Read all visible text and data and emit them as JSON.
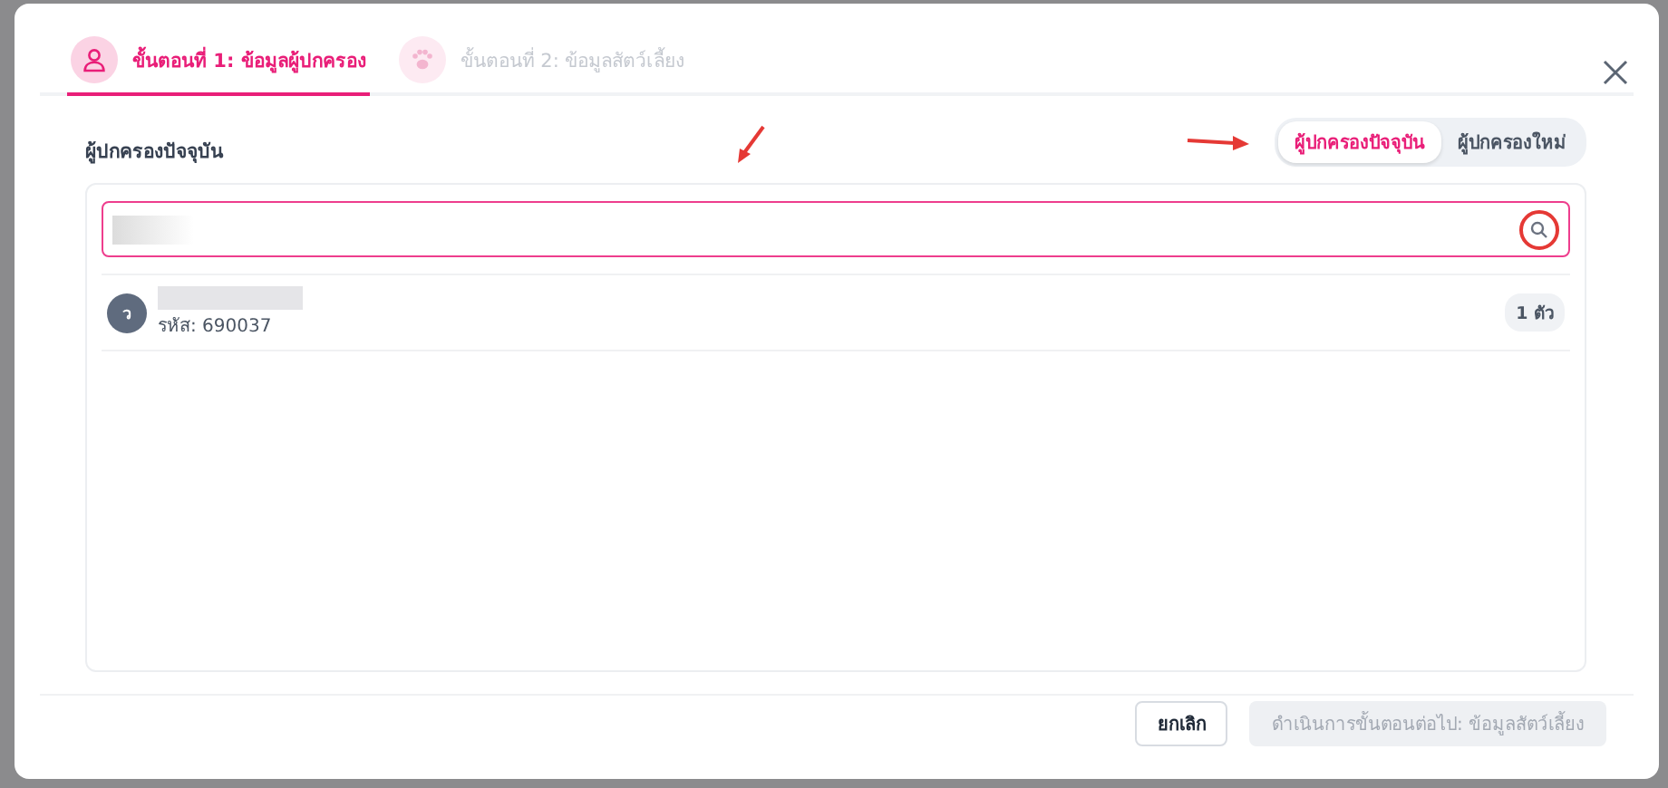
{
  "steps": [
    {
      "label": "ขั้นตอนที่ 1: ข้อมูลผู้ปกครอง",
      "kind": "person",
      "selected": true
    },
    {
      "label": "ขั้นตอนที่ 2: ข้อมูลสัตว์เลี้ยง",
      "kind": "paw",
      "selected": false
    }
  ],
  "section_title": "ผู้ปกครองปัจจุบัน",
  "mode_toggle": [
    {
      "label": "ผู้ปกครองปัจจุบัน",
      "selected": true
    },
    {
      "label": "ผู้ปกครองใหม่",
      "selected": false
    }
  ],
  "results": [
    {
      "avatar": "ว",
      "code": "รหัส: 690037",
      "badge": "1 ตัว"
    }
  ],
  "buttons": [
    {
      "label": "ยกเลิก",
      "disabled": false
    },
    {
      "label": "ดำเนินการขั้นตอนต่อไป: ข้อมูลสัตว์เลี้ยง",
      "disabled": true
    }
  ]
}
